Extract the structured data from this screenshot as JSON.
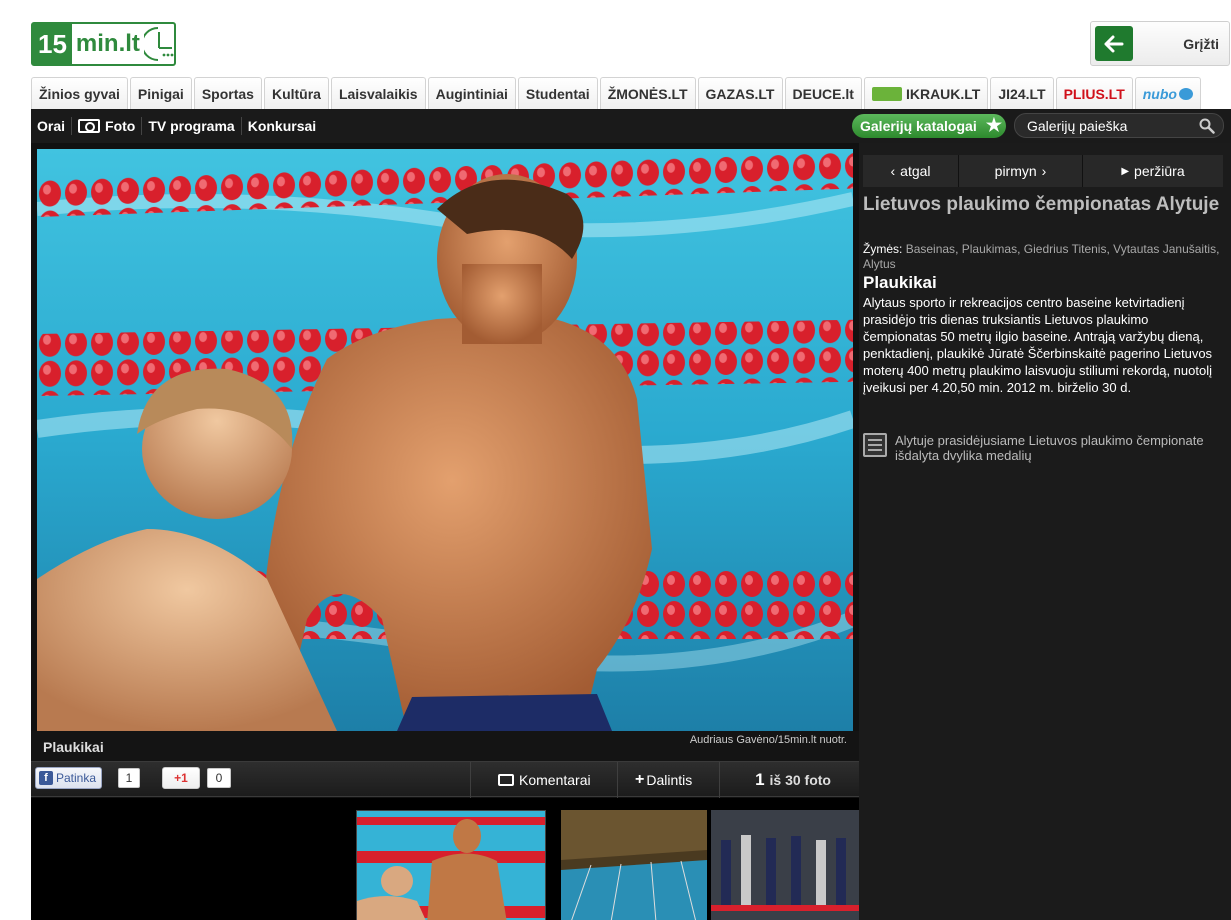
{
  "header": {
    "logo_number": "15",
    "logo_text": "min.lt",
    "back_label": "Grįžti"
  },
  "tabs": [
    {
      "label": "Žinios gyvai",
      "style": "normal"
    },
    {
      "label": "Pinigai",
      "style": "normal"
    },
    {
      "label": "Sportas",
      "style": "normal"
    },
    {
      "label": "Kultūra",
      "style": "normal"
    },
    {
      "label": "Laisvalaikis",
      "style": "normal"
    },
    {
      "label": "Augintiniai",
      "style": "normal"
    },
    {
      "label": "Studentai",
      "style": "normal"
    },
    {
      "label": "ŽMONĖS.LT",
      "style": "normal"
    },
    {
      "label": "GAZAS.LT",
      "style": "normal"
    },
    {
      "label": "DEUCE.lt",
      "style": "normal"
    },
    {
      "label": "IKRAUK.LT",
      "style": "ikrauk"
    },
    {
      "label": "JI24.LT",
      "style": "normal"
    },
    {
      "label": "PLIUS.LT",
      "style": "plius"
    },
    {
      "label": "nubo",
      "style": "nubo"
    }
  ],
  "nav": {
    "links": [
      "Orai",
      "Foto",
      "TV programa",
      "Konkursai"
    ],
    "catalog_label": "Galerijų katalogai",
    "search_placeholder": "Galerijų paieška"
  },
  "photo": {
    "caption": "Plaukikai",
    "credit": "Audriaus Gavėno/15min.lt nuotr."
  },
  "social": {
    "like_label": "Patinka",
    "like_count": "1",
    "gplus_label": "+1",
    "gplus_count": "0",
    "comments_label": "Komentarai",
    "share_label": "Dalintis",
    "counter_current": "1",
    "counter_text": "iš 30 foto"
  },
  "gallery_nav": {
    "prev": "atgal",
    "next": "pirmyn",
    "view": "peržiūra"
  },
  "gallery": {
    "title": "Lietuvos plaukimo čempionatas Alytuje",
    "tags_label": "Žymės:",
    "tags": [
      "Baseinas",
      "Plaukimas",
      "Giedrius Titenis",
      "Vytautas Janušaitis",
      "Alytus"
    ],
    "photo_title": "Plaukikai",
    "description": "Alytaus sporto ir rekreacijos centro baseine ketvirtadienį prasidėjo tris dienas truksiantis Lietuvos plaukimo čempionatas 50 metrų ilgio baseine. Antrąją varžybų dieną, penktadienį, plaukikė Jūratė Ščerbinskaitė pagerino Lietuvos moterų 400 metrų plaukimo laisvuoju stiliumi rekordą, nuotolį įveikusi per 4.20,50 min. 2012 m. birželio 30 d.",
    "related": "Alytuje prasidėjusiame Lietuvos plaukimo čempionate išdalyta dvylika medalių"
  },
  "colors": {
    "brand_green": "#2f8a3d",
    "plius_red": "#d0101a",
    "panel_dark": "#1b1b1b"
  }
}
